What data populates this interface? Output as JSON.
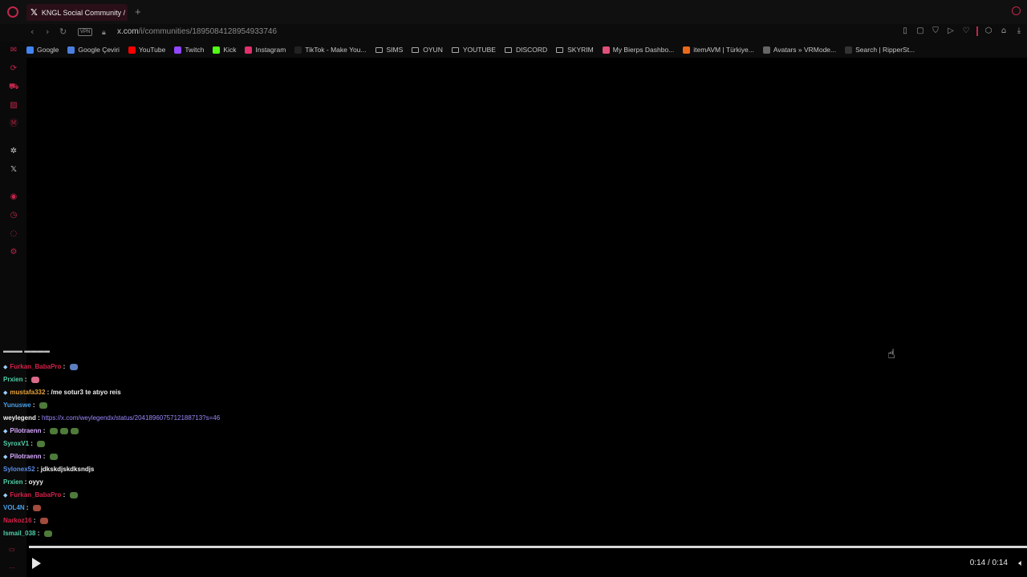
{
  "browser": {
    "tab_title": "KNGL Social Community /",
    "new_tab": "+",
    "vpn": "VPN",
    "url_host": "x.com",
    "url_path": "/i/communities/1895084128954933746"
  },
  "bookmarks": [
    {
      "label": "Google",
      "icon": "google-icon",
      "color": "#4285f4",
      "kind": "site"
    },
    {
      "label": "Google Çeviri",
      "icon": "translate-icon",
      "color": "#4a7fe0",
      "kind": "site"
    },
    {
      "label": "YouTube",
      "icon": "youtube-icon",
      "color": "#ff0000",
      "kind": "site"
    },
    {
      "label": "Twitch",
      "icon": "twitch-icon",
      "color": "#9146ff",
      "kind": "site"
    },
    {
      "label": "Kick",
      "icon": "kick-icon",
      "color": "#53fc18",
      "kind": "site"
    },
    {
      "label": "Instagram",
      "icon": "instagram-icon",
      "color": "#e1306c",
      "kind": "site"
    },
    {
      "label": "TikTok - Make You...",
      "icon": "tiktok-icon",
      "color": "#222222",
      "kind": "site"
    },
    {
      "label": "SIMS",
      "icon": "folder-icon",
      "kind": "folder"
    },
    {
      "label": "OYUN",
      "icon": "folder-icon",
      "kind": "folder"
    },
    {
      "label": "YOUTUBE",
      "icon": "folder-icon",
      "kind": "folder"
    },
    {
      "label": "DISCORD",
      "icon": "folder-icon",
      "kind": "folder"
    },
    {
      "label": "SKYRIM",
      "icon": "folder-icon",
      "kind": "folder"
    },
    {
      "label": "My Bierps Dashbo...",
      "icon": "bierps-icon",
      "color": "#e0507a",
      "kind": "site"
    },
    {
      "label": "itemAVM | Türkiye...",
      "icon": "itemavm-icon",
      "color": "#e86a1a",
      "kind": "site"
    },
    {
      "label": "Avatars » VRMode...",
      "icon": "vrmodels-icon",
      "color": "#666666",
      "kind": "site"
    },
    {
      "label": "Search | RipperSt...",
      "icon": "ripper-icon",
      "color": "#333333",
      "kind": "site"
    }
  ],
  "chat": {
    "lines": [
      {
        "user": "Furkan_BabaPro",
        "color": "#d8204a",
        "badge": true,
        "msg": "",
        "emotes": [
          "mix"
        ]
      },
      {
        "user": "Prxien",
        "color": "#4fd0a8",
        "badge": false,
        "msg": "",
        "emotes": [
          "pink"
        ]
      },
      {
        "user": "mustafa332",
        "color": "#e8a23a",
        "badge": true,
        "msg": "/me sotur3 te atıyo reis",
        "emotes": []
      },
      {
        "user": "Yunuswe",
        "color": "#4aa0e8",
        "badge": false,
        "msg": "",
        "emotes": [
          "frog"
        ]
      },
      {
        "user": "weylegend",
        "color": "#f0f0f0",
        "badge": false,
        "msg": "",
        "link": "https://x.com/weylegendx/status/2041896075712188713?s=46",
        "emotes": []
      },
      {
        "user": "Pilotraenn",
        "color": "#d7a8ff",
        "badge": true,
        "msg": "",
        "emotes": [
          "frog",
          "frog",
          "frog"
        ]
      },
      {
        "user": "SyroxV1",
        "color": "#4fd0a8",
        "badge": false,
        "msg": "",
        "emotes": [
          "frog"
        ]
      },
      {
        "user": "Pilotraenn",
        "color": "#d7a8ff",
        "badge": true,
        "msg": "",
        "emotes": [
          "frog"
        ]
      },
      {
        "user": "Sylonex52",
        "color": "#5b8ee8",
        "badge": false,
        "msg": "jdkskdjskdksndjs",
        "emotes": []
      },
      {
        "user": "Prxien",
        "color": "#4fd0a8",
        "badge": false,
        "msg": "oyyy",
        "emotes": []
      },
      {
        "user": "Furkan_BabaPro",
        "color": "#d8204a",
        "badge": true,
        "msg": "",
        "emotes": [
          "frog"
        ]
      },
      {
        "user": "VOL4N",
        "color": "#4aa0e8",
        "badge": false,
        "msg": "",
        "emotes": [
          "brick"
        ]
      },
      {
        "user": "Narkoz16",
        "color": "#d8204a",
        "badge": false,
        "msg": "",
        "emotes": [
          "brick"
        ]
      },
      {
        "user": "Ismail_038",
        "color": "#4fd0a8",
        "badge": false,
        "msg": "",
        "emotes": [
          "frog"
        ]
      }
    ],
    "separator": " : "
  },
  "video": {
    "time": "0:14 / 0:14",
    "progress": 1.0
  },
  "accent_color": "#c0264b"
}
